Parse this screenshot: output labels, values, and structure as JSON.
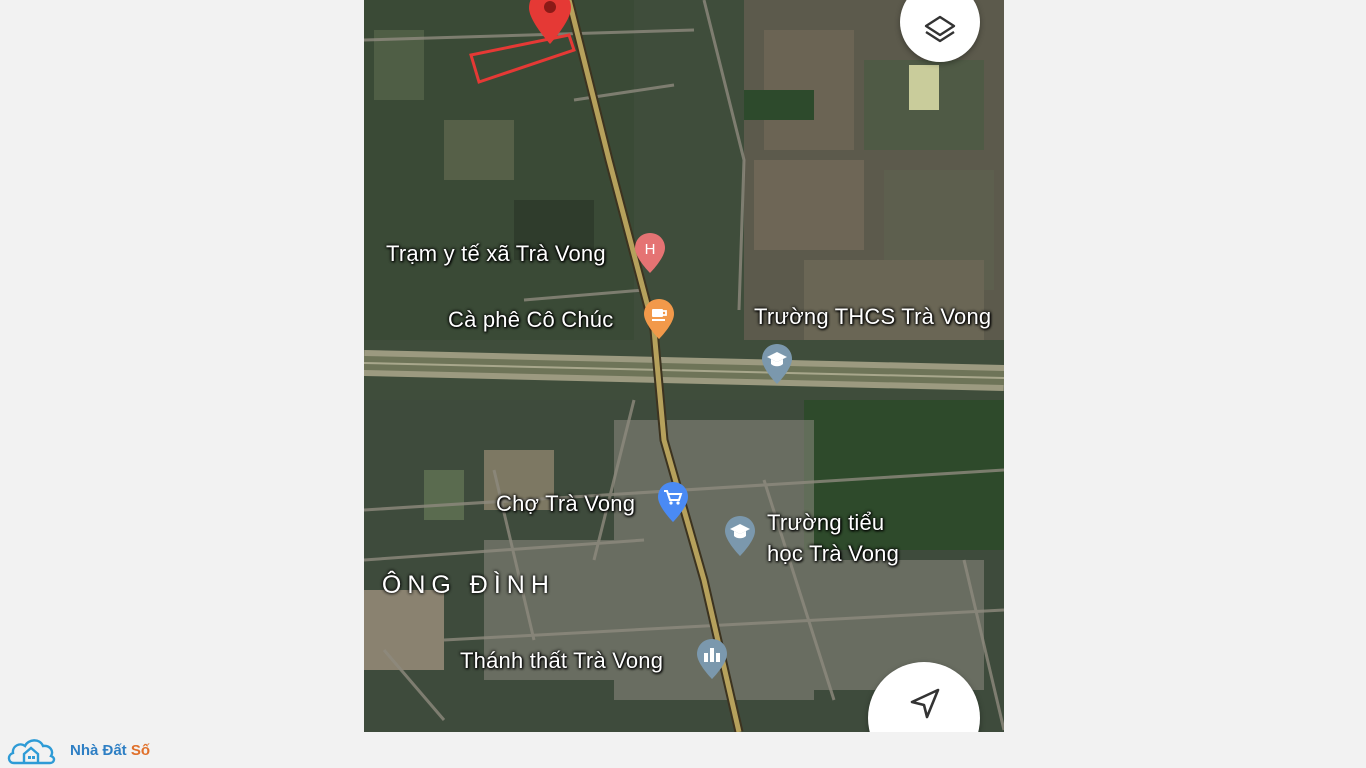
{
  "map": {
    "places": {
      "tram_y_te": "Trạm y tế xã Trà Vong",
      "ca_phe": "Cà phê Cô Chúc",
      "truong_thcs": "Trường THCS Trà Vong",
      "cho": "Chợ Trà Vong",
      "truong_tieu_hoc_line1": "Trường tiểu",
      "truong_tieu_hoc_line2": "học Trà Vong",
      "thanh_that": "Thánh thất Trà Vong"
    },
    "area_label": "ÔNG ĐÌNH",
    "icons": {
      "hospital": "hospital-pin-icon",
      "cafe": "cafe-pin-icon",
      "school": "school-pin-icon",
      "market": "shopping-cart-pin-icon",
      "temple": "temple-pin-icon",
      "location": "red-location-pin-icon",
      "layers": "layers-icon",
      "navigate": "navigation-arrow-icon"
    },
    "colors": {
      "hospital": "#e57373",
      "cafe": "#f2994a",
      "school": "#7b98ad",
      "market": "#4a8af4",
      "plot_outline": "#e53935"
    }
  },
  "watermark": {
    "brand_a": "Nhà Đất ",
    "brand_b": "Số"
  }
}
